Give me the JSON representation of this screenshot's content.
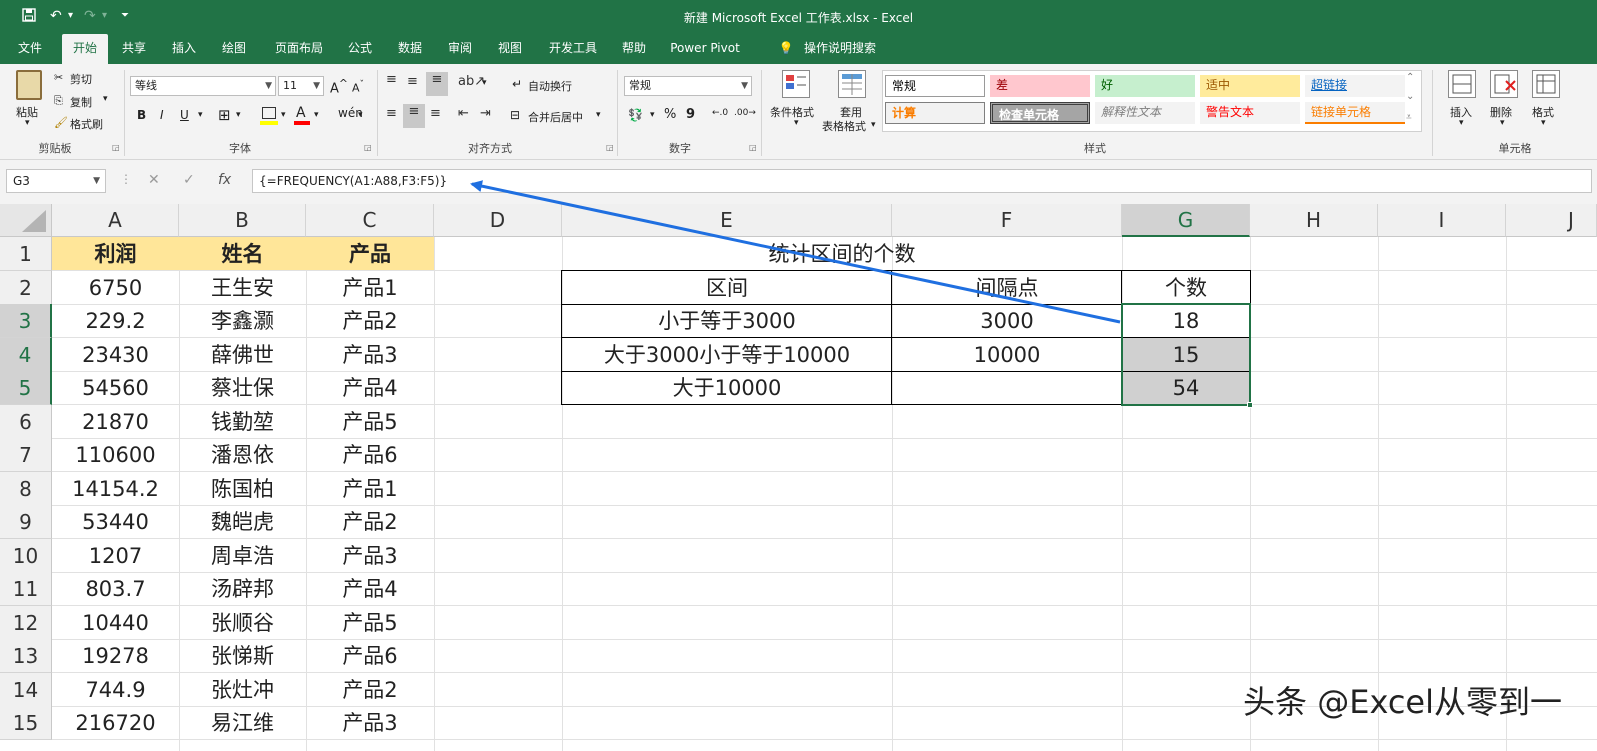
{
  "window_title": "新建 Microsoft Excel 工作表.xlsx  -  Excel",
  "quick_access": {
    "save_icon": "save-icon",
    "undo_icon": "undo-icon",
    "redo_icon": "redo-icon",
    "customize_icon": "customize-icon"
  },
  "tabs": [
    "文件",
    "开始",
    "共享",
    "插入",
    "绘图",
    "页面布局",
    "公式",
    "数据",
    "审阅",
    "视图",
    "开发工具",
    "帮助",
    "Power Pivot",
    "操作说明搜索"
  ],
  "active_tab": "开始",
  "ribbon": {
    "clipboard": {
      "paste": "粘贴",
      "cut": "剪切",
      "copy": "复制",
      "format_painter": "格式刷",
      "label": "剪贴板"
    },
    "font": {
      "name": "等线",
      "size": "11",
      "bold": "B",
      "italic": "I",
      "underline": "U",
      "label": "字体"
    },
    "alignment": {
      "wrap": "自动换行",
      "merge": "合并后居中",
      "label": "对齐方式"
    },
    "number": {
      "format": "常规",
      "percent": "%",
      "comma": "9",
      "label": "数字"
    },
    "styles": {
      "conditional": "条件格式",
      "table_format_1": "套用",
      "table_format_2": "表格格式",
      "label": "样式",
      "cells": [
        {
          "text": "常规",
          "bg": "#ffffff",
          "fg": "#000000"
        },
        {
          "text": "差",
          "bg": "#ffc7ce",
          "fg": "#9c0006"
        },
        {
          "text": "好",
          "bg": "#c6efce",
          "fg": "#006100"
        },
        {
          "text": "适中",
          "bg": "#ffeb9c",
          "fg": "#9c5700"
        },
        {
          "text": "超链接",
          "bg": "#f3f3f3",
          "fg": "#0563c1"
        },
        {
          "text": "计算",
          "bg": "#f2f2f2",
          "fg": "#fa7d00"
        },
        {
          "text": "检查单元格",
          "bg": "#a5a5a5",
          "fg": "#ffffff"
        },
        {
          "text": "解释性文本",
          "bg": "#f3f3f3",
          "fg": "#7f7f7f"
        },
        {
          "text": "警告文本",
          "bg": "#f3f3f3",
          "fg": "#ff0000"
        },
        {
          "text": "链接单元格",
          "bg": "#f3f3f3",
          "fg": "#fa7d00"
        }
      ]
    },
    "cells_group": {
      "insert": "插入",
      "delete": "删除",
      "format": "格式",
      "label": "单元格"
    }
  },
  "name_box": "G3",
  "formula": "{=FREQUENCY(A1:A88,F3:F5)}",
  "columns": [
    "A",
    "B",
    "C",
    "D",
    "E",
    "F",
    "G",
    "H",
    "I",
    "J"
  ],
  "rows": [
    "1",
    "2",
    "3",
    "4",
    "5",
    "6",
    "7",
    "8",
    "9",
    "10",
    "11",
    "12",
    "13",
    "14",
    "15"
  ],
  "selected_column": "G",
  "selected_rows": [
    "3",
    "4",
    "5"
  ],
  "headers": {
    "a": "利润",
    "b": "姓名",
    "c": "产品"
  },
  "data_rows": [
    [
      "6750",
      "王生安",
      "产品1"
    ],
    [
      "229.2",
      "李鑫灏",
      "产品2"
    ],
    [
      "23430",
      "薛佛世",
      "产品3"
    ],
    [
      "54560",
      "蔡壮保",
      "产品4"
    ],
    [
      "21870",
      "钱勤堃",
      "产品5"
    ],
    [
      "110600",
      "潘恩依",
      "产品6"
    ],
    [
      "14154.2",
      "陈国柏",
      "产品1"
    ],
    [
      "53440",
      "魏皑虎",
      "产品2"
    ],
    [
      "1207",
      "周卓浩",
      "产品3"
    ],
    [
      "803.7",
      "汤辟邦",
      "产品4"
    ],
    [
      "10440",
      "张顺谷",
      "产品5"
    ],
    [
      "19278",
      "张悌斯",
      "产品6"
    ],
    [
      "744.9",
      "张灶冲",
      "产品2"
    ],
    [
      "216720",
      "易江维",
      "产品3"
    ]
  ],
  "summary": {
    "title": "统计区间的个数",
    "headers": [
      "区间",
      "间隔点",
      "个数"
    ],
    "rows": [
      [
        "小于等于3000",
        "3000",
        "18"
      ],
      [
        "大于3000小于等于10000",
        "10000",
        "15"
      ],
      [
        "大于10000",
        "",
        "54"
      ]
    ]
  },
  "annotation_arrow_color": "#1f6fe0",
  "accent": "#217346",
  "watermark": "头条 @Excel从零到一"
}
